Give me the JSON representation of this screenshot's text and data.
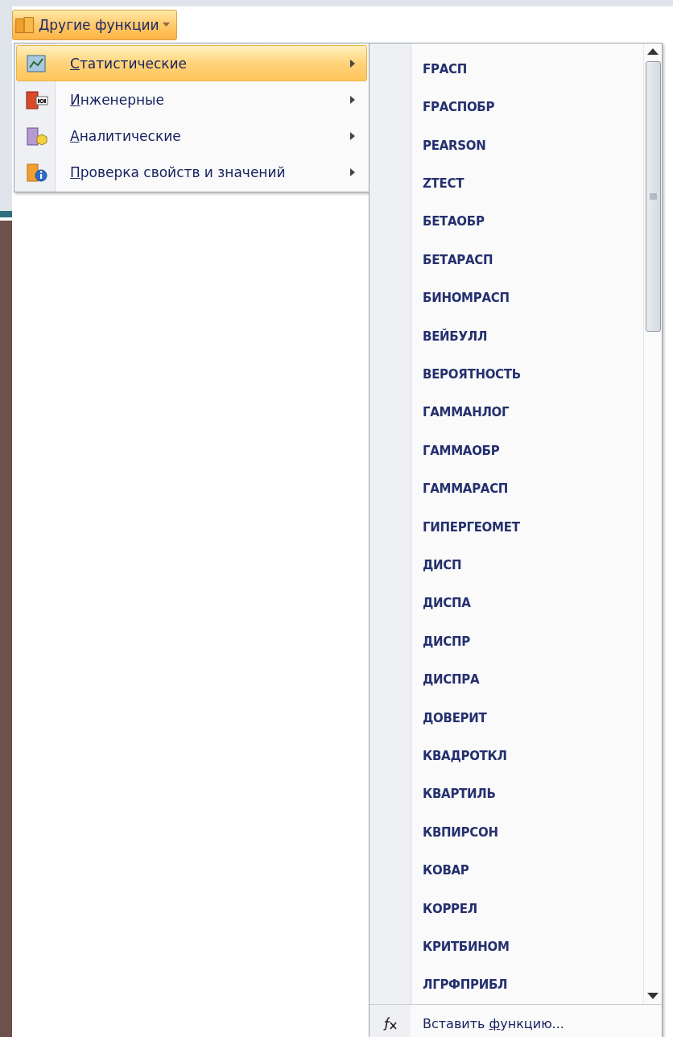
{
  "ribbon_button": {
    "label": "Другие функции"
  },
  "menu": {
    "items": [
      {
        "accel": "С",
        "rest": "татистические",
        "selected": true,
        "kind": "chart"
      },
      {
        "accel": "И",
        "rest": "нженерные",
        "selected": false,
        "kind": "numbers"
      },
      {
        "accel": "А",
        "rest": "налитические",
        "selected": false,
        "kind": "cube"
      },
      {
        "accel": "П",
        "rest": "роверка свойств и значений",
        "selected": false,
        "kind": "info"
      }
    ]
  },
  "submenu": {
    "functions": [
      "FРАСП",
      "FРАСПОБР",
      "PEARSON",
      "ZTECT",
      "БЕТАОБР",
      "БЕТАРАСП",
      "БИНОМРАСП",
      "ВЕЙБУЛЛ",
      "ВЕРОЯТНОСТЬ",
      "ГАММАНЛОГ",
      "ГАММАОБР",
      "ГАММАРАСП",
      "ГИПЕРГЕОМЕТ",
      "ДИСП",
      "ДИСПА",
      "ДИСПР",
      "ДИСПРА",
      "ДОВЕРИТ",
      "КВАДРОТКЛ",
      "КВАРТИЛЬ",
      "КВПИРСОН",
      "КОВАР",
      "КОРРЕЛ",
      "КРИТБИНОМ",
      "ЛГРФПРИБЛ"
    ],
    "footer": {
      "lead": "Вставить ",
      "accel": "ф",
      "rest": "ункцию..."
    }
  }
}
